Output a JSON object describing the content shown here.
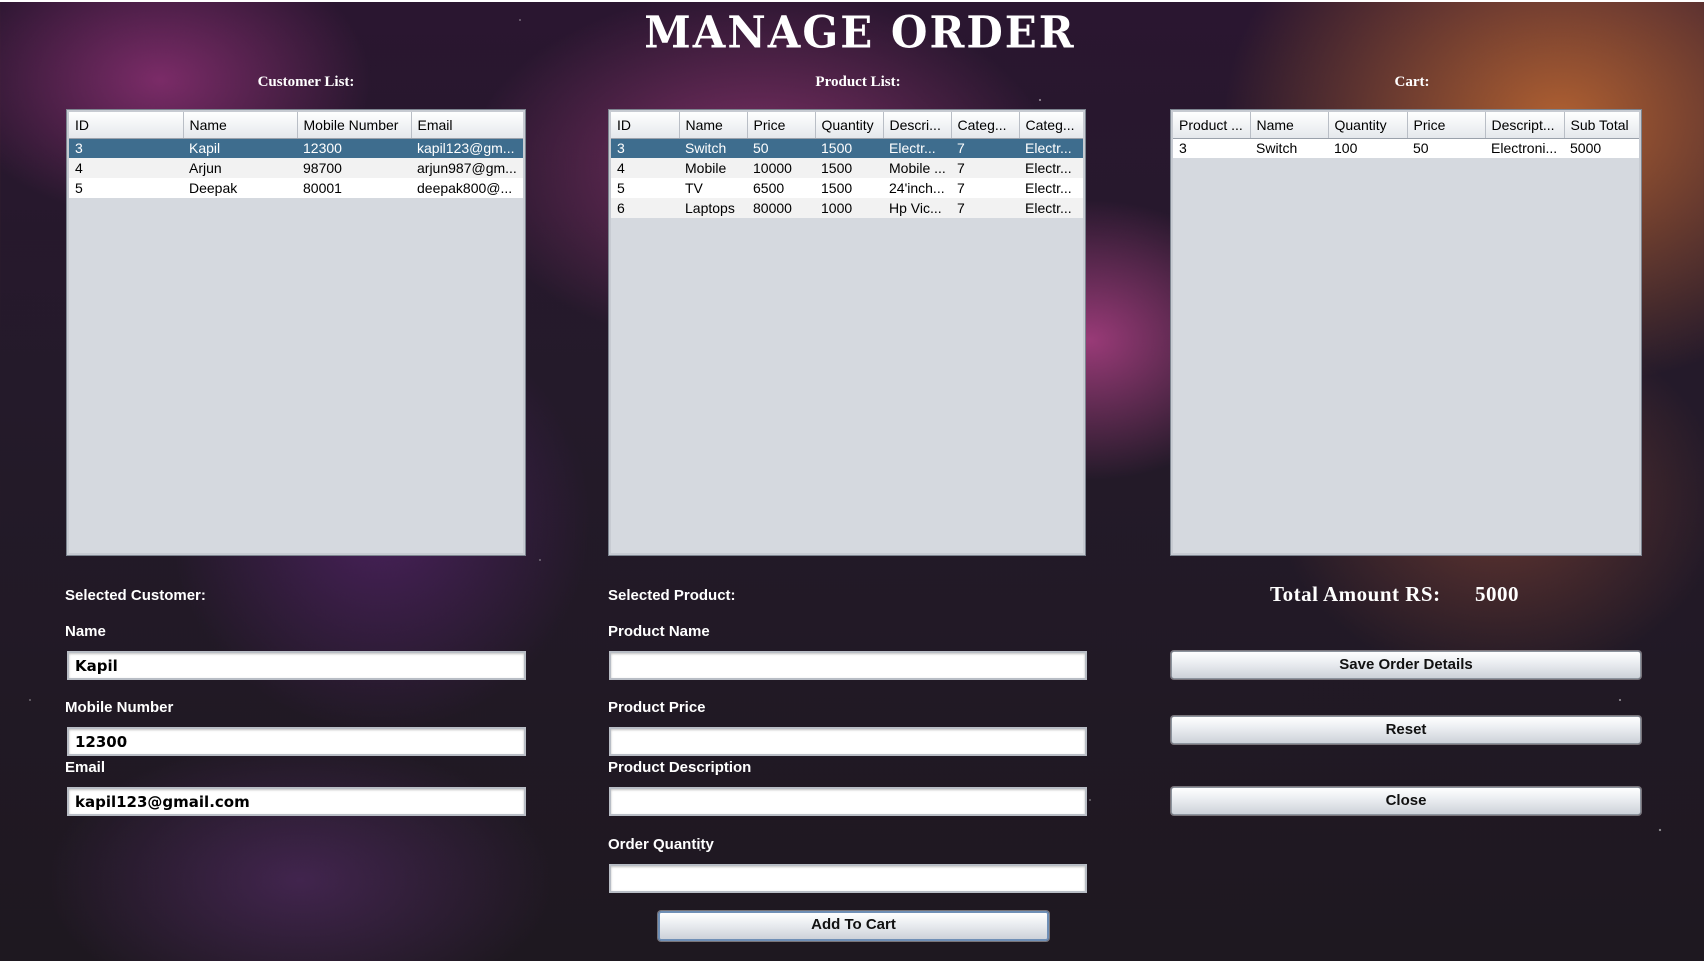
{
  "title": "MANAGE ORDER",
  "customer_list": {
    "label": "Customer List:",
    "columns": [
      "ID",
      "Name",
      "Mobile Number",
      "Email"
    ],
    "rows": [
      [
        "3",
        "Kapil",
        "12300",
        "kapil123@gm..."
      ],
      [
        "4",
        "Arjun",
        "98700",
        "arjun987@gm..."
      ],
      [
        "5",
        "Deepak",
        "80001",
        "deepak800@..."
      ]
    ],
    "selected_index": 0
  },
  "product_list": {
    "label": "Product List:",
    "columns": [
      "ID",
      "Name",
      "Price",
      "Quantity",
      "Descri...",
      "Categ...",
      "Categ..."
    ],
    "rows": [
      [
        "3",
        "Switch",
        "50",
        "1500",
        "Electr...",
        "7",
        "Electr..."
      ],
      [
        "4",
        "Mobile",
        "10000",
        "1500",
        "Mobile ...",
        "7",
        "Electr..."
      ],
      [
        "5",
        "TV",
        "6500",
        "1500",
        "24'inch...",
        "7",
        "Electr..."
      ],
      [
        "6",
        "Laptops",
        "80000",
        "1000",
        "Hp Vic...",
        "7",
        "Electr..."
      ]
    ],
    "selected_index": 0
  },
  "cart": {
    "label": "Cart:",
    "columns": [
      "Product ...",
      "Name",
      "Quantity",
      "Price",
      "Descript...",
      "Sub Total"
    ],
    "rows": [
      [
        "3",
        "Switch",
        "100",
        "50",
        "Electroni...",
        "5000"
      ]
    ]
  },
  "selected_customer": {
    "heading": "Selected Customer:",
    "name_label": "Name",
    "name_value": "Kapil",
    "mobile_label": "Mobile Number",
    "mobile_value": "12300",
    "email_label": "Email",
    "email_value": "kapil123@gmail.com"
  },
  "selected_product": {
    "heading": "Selected Product:",
    "name_label": "Product Name",
    "name_value": "",
    "price_label": "Product Price",
    "price_value": "",
    "description_label": "Product Description",
    "description_value": "",
    "quantity_label": "Order Quantity",
    "quantity_value": ""
  },
  "total": {
    "label": "Total Amount RS:",
    "value": "5000"
  },
  "buttons": {
    "save": "Save Order Details",
    "reset": "Reset",
    "close": "Close",
    "add_to_cart": "Add To Cart"
  },
  "colors": {
    "selection": "#3e6d8e",
    "table_background": "#d5d9df"
  }
}
